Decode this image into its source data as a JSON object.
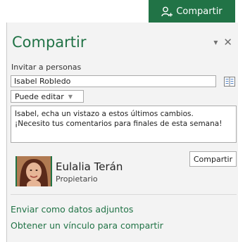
{
  "topbar": {
    "share_tab_label": "Compartir"
  },
  "pane": {
    "title": "Compartir",
    "invite_label": "Invitar a personas",
    "invite_value": "Isabel Robledo",
    "permission_selected": "Puede editar",
    "message": "Isabel, echa un vistazo a estos últimos cambios.\n¡Necesito tus comentarios para finales de esta semana!",
    "share_button_label": "Compartir",
    "owner": {
      "name": "Eulalia Terán",
      "role": "Propietario"
    },
    "links": {
      "send_attachment": "Enviar como datos adjuntos",
      "get_link": "Obtener un vínculo para compartir"
    }
  },
  "colors": {
    "accent": "#217346",
    "pane_background": "#f3f3f3"
  },
  "icons": {
    "share": "person-add-icon",
    "address_book": "address-book-icon",
    "options": "chevron-down-icon",
    "close": "close-icon"
  }
}
